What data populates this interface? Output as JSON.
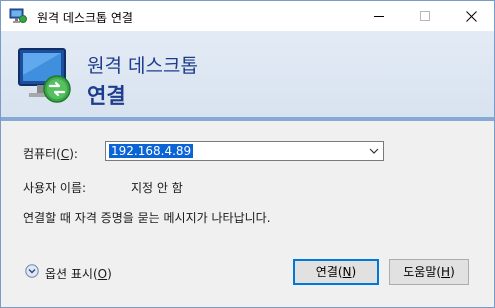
{
  "window": {
    "title": "원격 데스크톱 연결"
  },
  "banner": {
    "line1": "원격 데스크톱",
    "line2": "연결"
  },
  "form": {
    "computer_label_text": "컴퓨터(",
    "computer_label_key": "C",
    "computer_label_end": "):",
    "computer_value": "192.168.4.89",
    "user_label": "사용자 이름:",
    "user_value": "지정 안 함",
    "info_text": "연결할 때 자격 증명을 묻는 메시지가 나타납니다."
  },
  "footer": {
    "options_text": "옵션 표시(",
    "options_key": "O",
    "options_end": ")",
    "connect_text": "연결(",
    "connect_key": "N",
    "connect_end": ")",
    "help_text": "도움말(",
    "help_key": "H",
    "help_end": ")"
  },
  "icons": {
    "title_icon": "remote-desktop-icon",
    "banner_icon": "remote-desktop-monitor-icon",
    "combo_arrow": "chevron-down-icon",
    "expander": "expand-circle-icon"
  },
  "colors": {
    "banner_title": "#1e3d8c",
    "selection": "#0a64d6",
    "default_button_border": "#0078d7"
  }
}
